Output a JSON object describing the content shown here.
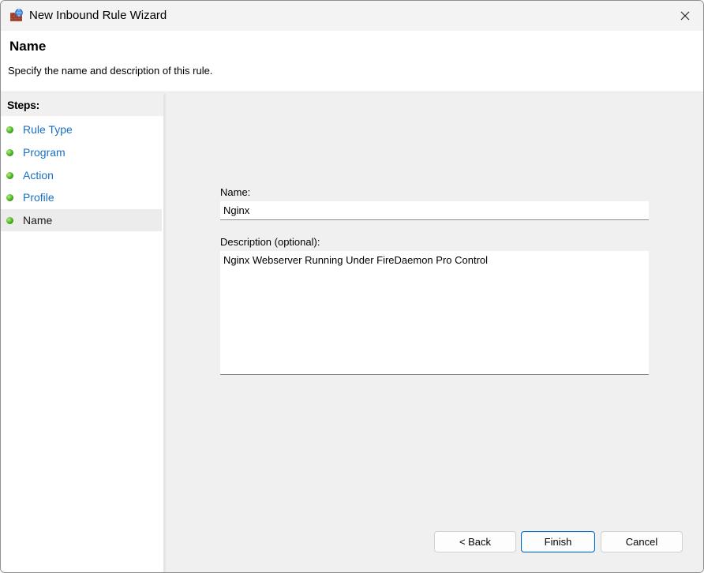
{
  "window": {
    "title": "New Inbound Rule Wizard",
    "icon": "firewall-icon"
  },
  "header": {
    "title": "Name",
    "subtitle": "Specify the name and description of this rule."
  },
  "steps": {
    "heading": "Steps:",
    "items": [
      {
        "label": "Rule Type",
        "active": false
      },
      {
        "label": "Program",
        "active": false
      },
      {
        "label": "Action",
        "active": false
      },
      {
        "label": "Profile",
        "active": false
      },
      {
        "label": "Name",
        "active": true
      }
    ]
  },
  "form": {
    "name_label": "Name:",
    "name_value": "Nginx",
    "description_label": "Description (optional):",
    "description_value": "Nginx Webserver Running Under FireDaemon Pro Control"
  },
  "buttons": {
    "back": "< Back",
    "finish": "Finish",
    "cancel": "Cancel"
  },
  "colors": {
    "link": "#1a6fc4",
    "step_dot": "#3fa61e",
    "primary_border": "#0067c0"
  }
}
